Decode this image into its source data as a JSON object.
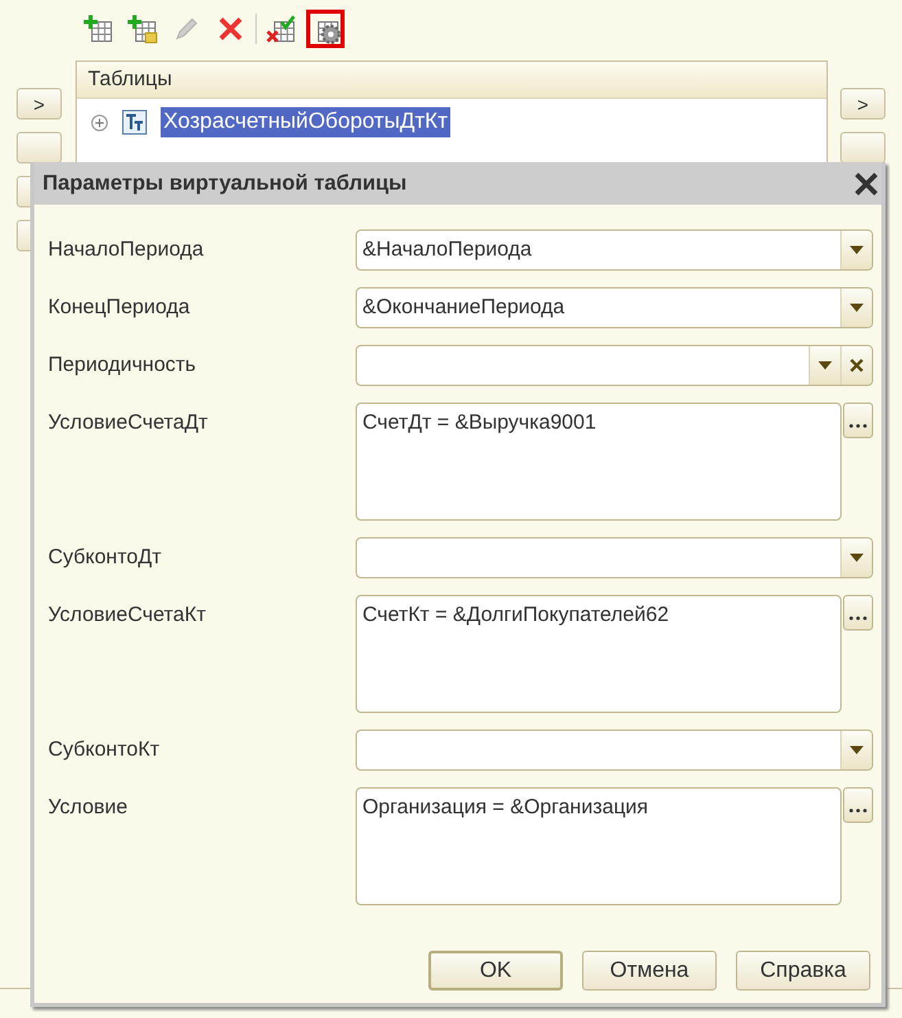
{
  "toolbar": [
    {
      "kind": "table-add",
      "disabled": false,
      "highlighted": false
    },
    {
      "kind": "table-copy",
      "disabled": false,
      "highlighted": false
    },
    {
      "kind": "edit",
      "disabled": true,
      "highlighted": false
    },
    {
      "kind": "delete",
      "disabled": false,
      "highlighted": false
    },
    {
      "kind": "table-check",
      "disabled": false,
      "highlighted": false
    },
    {
      "kind": "table-settings",
      "disabled": false,
      "highlighted": true
    }
  ],
  "tables_panel": {
    "title": "Таблицы",
    "items": [
      {
        "label": "ХозрасчетныйОборотыДтКт",
        "selected": true,
        "expanded": false
      }
    ]
  },
  "left_buttons": [
    {
      "label": ">"
    }
  ],
  "right_buttons": [
    {
      "label": ">"
    }
  ],
  "dialog": {
    "title": "Параметры виртуальной таблицы",
    "fields": [
      {
        "label": "НачалоПериода",
        "kind": "dropdown",
        "value": "&НачалоПериода"
      },
      {
        "label": "КонецПериода",
        "kind": "dropdown",
        "value": "&ОкончаниеПериода"
      },
      {
        "label": "Периодичность",
        "kind": "dropdown-clear"
      },
      {
        "label": "УсловиеСчетаДт",
        "kind": "textarea",
        "value": "СчетДт = &Выручка9001"
      },
      {
        "label": "СубконтоДт",
        "kind": "dropdown"
      },
      {
        "label": "УсловиеСчетаКт",
        "kind": "textarea",
        "value": "СчетКт = &ДолгиПокупателей62"
      },
      {
        "label": "СубконтоКт",
        "kind": "dropdown"
      },
      {
        "label": "Условие",
        "kind": "textarea",
        "value": "Организация = &Организация"
      }
    ],
    "buttons": [
      {
        "label": "OK",
        "default": true
      },
      {
        "label": "Отмена",
        "default": false
      },
      {
        "label": "Справка",
        "default": false
      }
    ]
  }
}
